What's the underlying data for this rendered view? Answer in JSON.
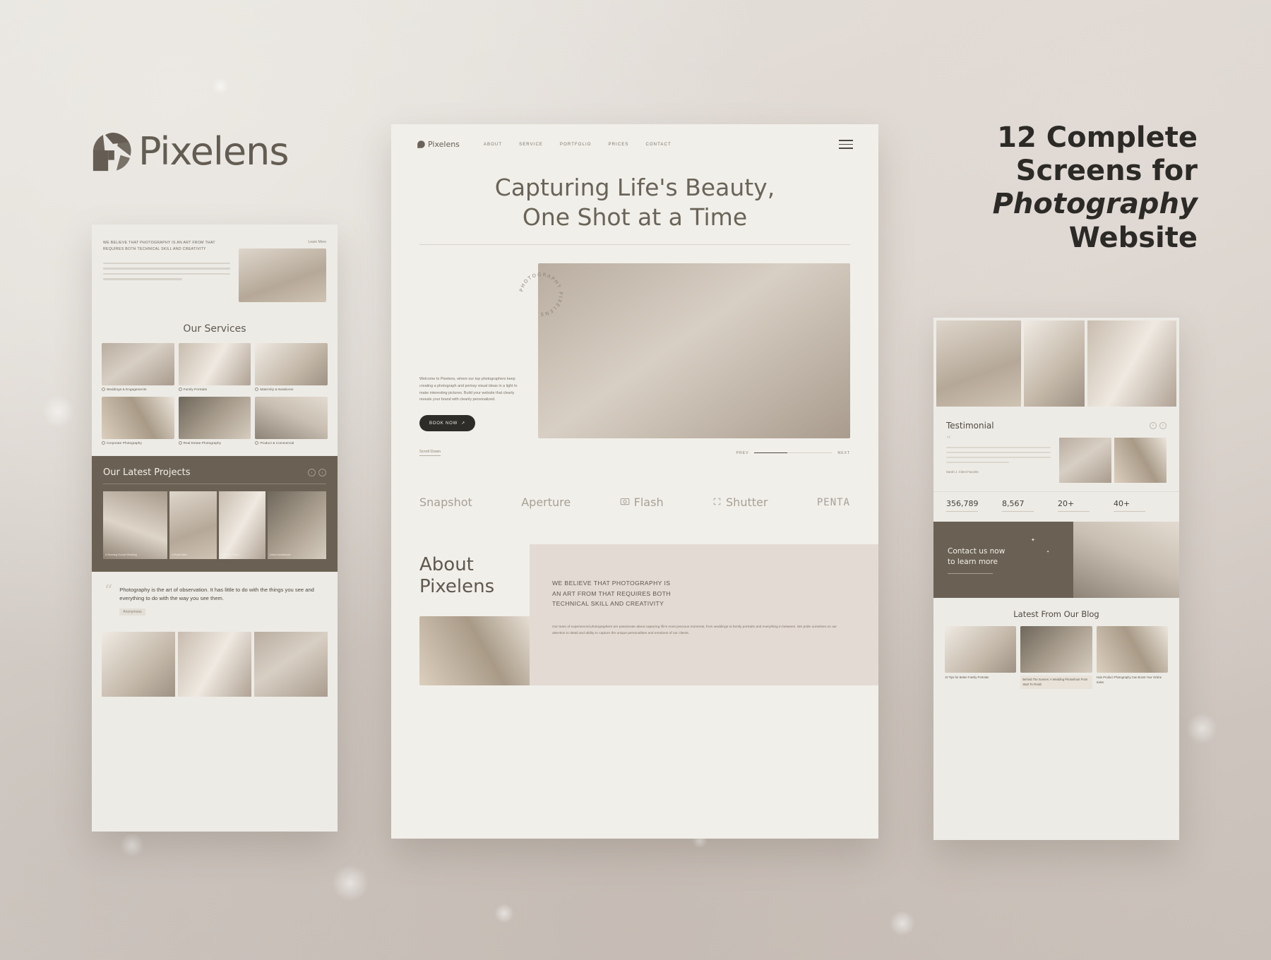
{
  "brand": {
    "name": "Pixelens",
    "icon": "aperture-icon",
    "color": "#635c52"
  },
  "promo": {
    "line1": "12 Complete",
    "line2": "Screens for",
    "line3": "Photography",
    "line4": "Website"
  },
  "center_screen": {
    "logo": "Pixelens",
    "nav": [
      {
        "label": "ABOUT"
      },
      {
        "label": "SERVICE"
      },
      {
        "label": "PORTFOLIO"
      },
      {
        "label": "PRICES"
      },
      {
        "label": "CONTACT"
      }
    ],
    "menu_icon": "hamburger-icon",
    "hero": {
      "title_line1": "Capturing Life's Beauty,",
      "title_line2": "One Shot at a Time",
      "badge_text": "PHOTOGRAPHY PIXELENS",
      "paragraph": "Welcome to Pixelens, where our top photographers keep creating a photograph and portray visual ideas in a light to make interesting pictures. Build your website that clearly reveals your brand with cleanly personalized.",
      "cta_label": "BOOK NOW",
      "cta_icon": "arrow-right-icon",
      "scroll_label": "Scroll Down",
      "pager_current": "PREV",
      "pager_next": "NEXT"
    },
    "brands": [
      {
        "label": "Snapshot",
        "icon": ""
      },
      {
        "label": "Aperture",
        "icon": ""
      },
      {
        "label": "Flash",
        "icon": "camera-icon"
      },
      {
        "label": "Shutter",
        "icon": "shutter-icon"
      },
      {
        "label": "PENTA",
        "icon": ""
      }
    ],
    "about": {
      "title_line1": "About",
      "title_line2": "Pixelens",
      "statement_line1": "WE BELIEVE THAT PHOTOGRAPHY IS",
      "statement_line2": "AN ART FROM THAT REQUIRES BOTH",
      "statement_line3": "TECHNICAL SKILL AND CREATIVITY",
      "body": "Our team of experienced photographers are passionate about capturing life's most precious moments, from weddings to family portraits and everything in between. We pride ourselves on our attention to detail and ability to capture the unique personalities and emotions of our clients."
    }
  },
  "left_screen": {
    "hero_kicker": "WE BELIEVE THAT PHOTOGRAPHY IS AN ART FROM THAT REQUIRES BOTH TECHNICAL SKILL AND CREATIVITY",
    "hero_tag": "Learn More",
    "services_title": "Our Services",
    "services": [
      {
        "label": "Weddings & Engagements"
      },
      {
        "label": "Family Portraits"
      },
      {
        "label": "Maternity & Newborns"
      },
      {
        "label": "Corporate Photography"
      },
      {
        "label": "Real Estate Photography"
      },
      {
        "label": "Product & Commercial"
      }
    ],
    "projects_title": "Our Latest Projects",
    "projects": [
      {
        "label": "A Stunning Sunset Wedding"
      },
      {
        "label": "A Rustic Barn"
      },
      {
        "label": "A Modern Home"
      },
      {
        "label": "Urban Architecture"
      }
    ],
    "quote": "Photography is the art of observation. It has little to do with the things you see and everything to do with the way you see them.",
    "quote_author": "Anonymous"
  },
  "right_screen": {
    "testimonial_title": "Testimonial",
    "testimonial_author": "Sarah J. Client Favorite",
    "stats": [
      {
        "value": "356,789"
      },
      {
        "value": "8,567"
      },
      {
        "value": "20+"
      },
      {
        "value": "40+"
      }
    ],
    "contact_line1": "Contact us now",
    "contact_line2": "to learn more",
    "blog_title": "Latest From Our Blog",
    "blog_posts": [
      {
        "title": "10 Tips for Better Family Portraits"
      },
      {
        "title": "Behind The Scenes: A Wedding Photoshoot From Start To Finish"
      },
      {
        "title": "How Product Photography Can Boost Your Online Sales"
      }
    ]
  }
}
